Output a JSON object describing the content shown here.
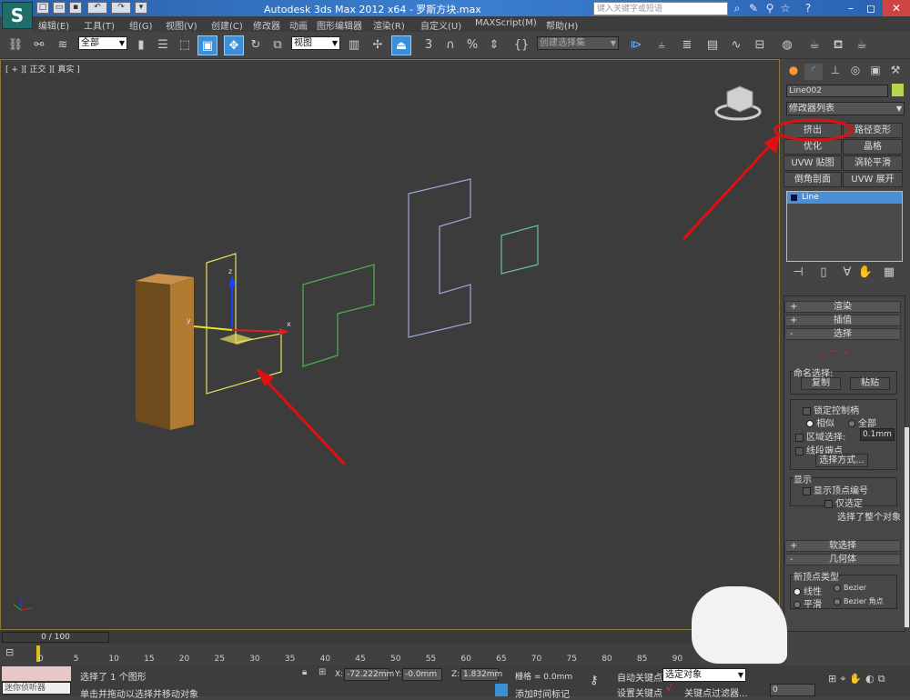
{
  "titlebar": {
    "title": "Autodesk 3ds Max  2012 x64  - 罗斯方块.max",
    "search_placeholder": "键入关键字或短语",
    "logo": "S"
  },
  "menu": [
    "编辑(E)",
    "工具(T)",
    "组(G)",
    "视图(V)",
    "创建(C)",
    "修改器",
    "动画",
    "图形编辑器",
    "渲染(R)",
    "自定义(U)",
    "MAXScript(M)",
    "帮助(H)"
  ],
  "toolbar": {
    "selection_filter": "全部",
    "ref_coord": "视图",
    "named_selection": "创建选择集",
    "snap_label": "3"
  },
  "viewport": {
    "label": "[ + ][ 正交 ][ 真实 ]",
    "axis_x": "x",
    "axis_y": "y",
    "axis_z": "z"
  },
  "command_panel": {
    "object_name": "Line002",
    "object_color": "#b5d553",
    "modifier_list": "修改器列表",
    "modifier_buttons": [
      "挤出",
      "路径变形",
      "优化",
      "晶格",
      "UVW 贴图",
      "涡轮平滑",
      "倒角剖面",
      "UVW 展开"
    ],
    "stack": [
      "Line"
    ],
    "rollouts": {
      "render": "渲染",
      "interp": "插值",
      "selection": "选择",
      "soft": "软选择",
      "geometry": "几何体"
    },
    "selection": {
      "named_sel": "命名选择:",
      "copy": "复制",
      "paste": "粘贴",
      "lock_handles": "锁定控制柄",
      "alike": "相似",
      "all": "全部",
      "area_sel": "区域选择:",
      "area_value": "0.1mm",
      "segment_end": "线段端点",
      "select_by": "选择方式...",
      "display": "显示",
      "show_vertex_numbers": "显示顶点编号",
      "selected_only": "仅选定",
      "status": "选择了整个对象"
    },
    "geometry": {
      "new_vertex_type": "新顶点类型",
      "linear": "线性",
      "bezier": "Bezier",
      "smooth": "平滑",
      "bezier_corner": "Bezier 角点"
    }
  },
  "timeline": {
    "position": "0 / 100",
    "ticks": [
      "0",
      "5",
      "10",
      "15",
      "20",
      "25",
      "30",
      "35",
      "40",
      "45",
      "50",
      "55",
      "60",
      "65",
      "70",
      "75",
      "80",
      "85",
      "90"
    ]
  },
  "status": {
    "selected": "选择了 1 个图形",
    "prompt": "单击并拖动以选择并移动对象",
    "x": "-72.222mm",
    "y": "-0.0mm",
    "z": "1.832mm",
    "grid": "栅格 = 0.0mm",
    "add_time_tag": "添加时间标记",
    "auto_key": "自动关键点",
    "set_key": "设置关键点",
    "key_mode": "选定对象",
    "key_filters": "关键点过滤器...",
    "frame": "0",
    "listener": "迷你侦听器",
    "x_label": "X:",
    "y_label": "Y:",
    "z_label": "Z:"
  },
  "colors": {
    "accent": "#3b8fd8",
    "annotation": "#e01010",
    "selected_shape": "#e8e060",
    "orange_box": "#b07a30"
  }
}
